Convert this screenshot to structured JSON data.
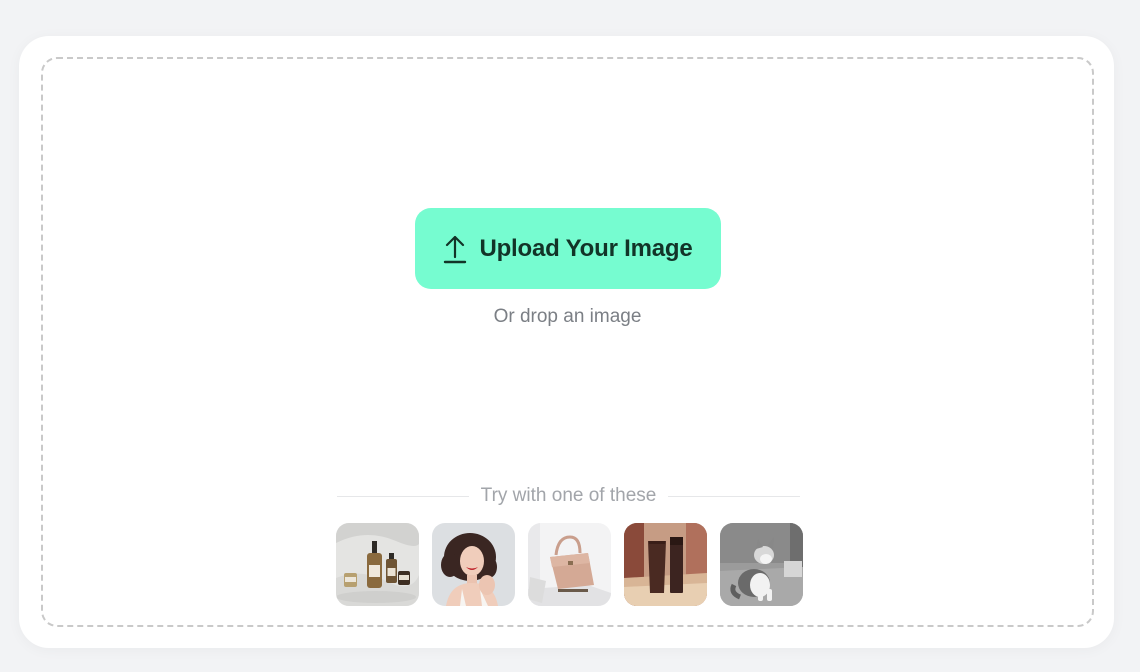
{
  "upload": {
    "button_label": "Upload Your Image",
    "icon": "upload-arrow-icon",
    "drop_hint": "Or drop an image"
  },
  "samples": {
    "heading": "Try with one of these",
    "items": [
      {
        "name": "skincare-bottles",
        "description": "Serum bottles and jars on white fabric"
      },
      {
        "name": "smiling-woman",
        "description": "Smiling woman with curly hair"
      },
      {
        "name": "pink-handbag",
        "description": "Pink leather handbag"
      },
      {
        "name": "cosmetic-tubes",
        "description": "Brown cosmetic tubes on terracotta background"
      },
      {
        "name": "kitten",
        "description": "Grey and white kitten sitting"
      }
    ]
  },
  "colors": {
    "accent": "#76fcd0",
    "accent_text": "#123428",
    "background": "#f2f3f5",
    "dashed_border": "#c9c9c9"
  }
}
